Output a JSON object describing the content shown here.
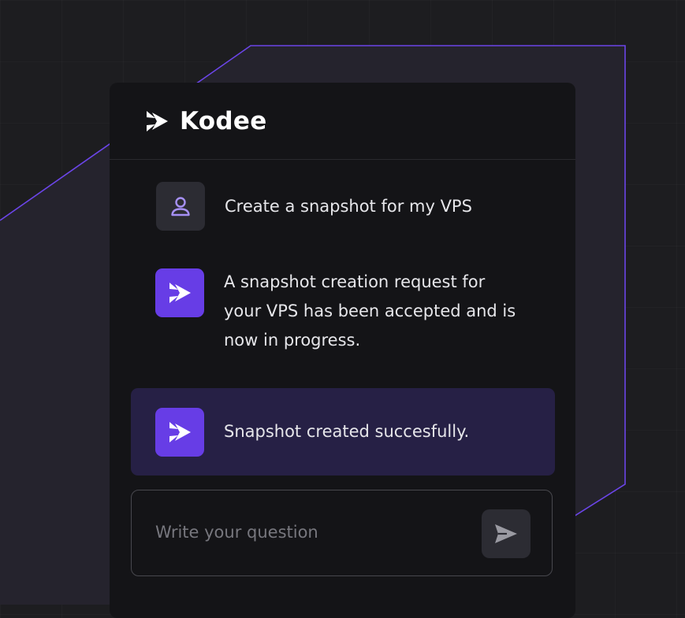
{
  "app": {
    "brand_name": "Kodee"
  },
  "chat": {
    "messages": [
      {
        "role": "user",
        "icon": "user-icon",
        "text": "Create a snapshot for my VPS"
      },
      {
        "role": "assistant",
        "icon": "kodee-logo-icon",
        "lines": [
          "A snapshot creation request for",
          "your VPS has been accepted and is",
          "now in progress."
        ]
      },
      {
        "role": "assistant",
        "icon": "kodee-logo-icon",
        "text": "Snapshot created succesfully.",
        "highlighted": true
      }
    ]
  },
  "composer": {
    "placeholder": "Write your question",
    "value": "",
    "send_icon": "send-icon"
  },
  "colors": {
    "background": "#1d1d20",
    "panel": "#141417",
    "accent": "#673de6",
    "accent_outline": "#6b45e8",
    "highlight_bg": "#262045",
    "text": "#e6e6ea",
    "placeholder": "#77777e",
    "icon_tile": "#2c2c33"
  }
}
